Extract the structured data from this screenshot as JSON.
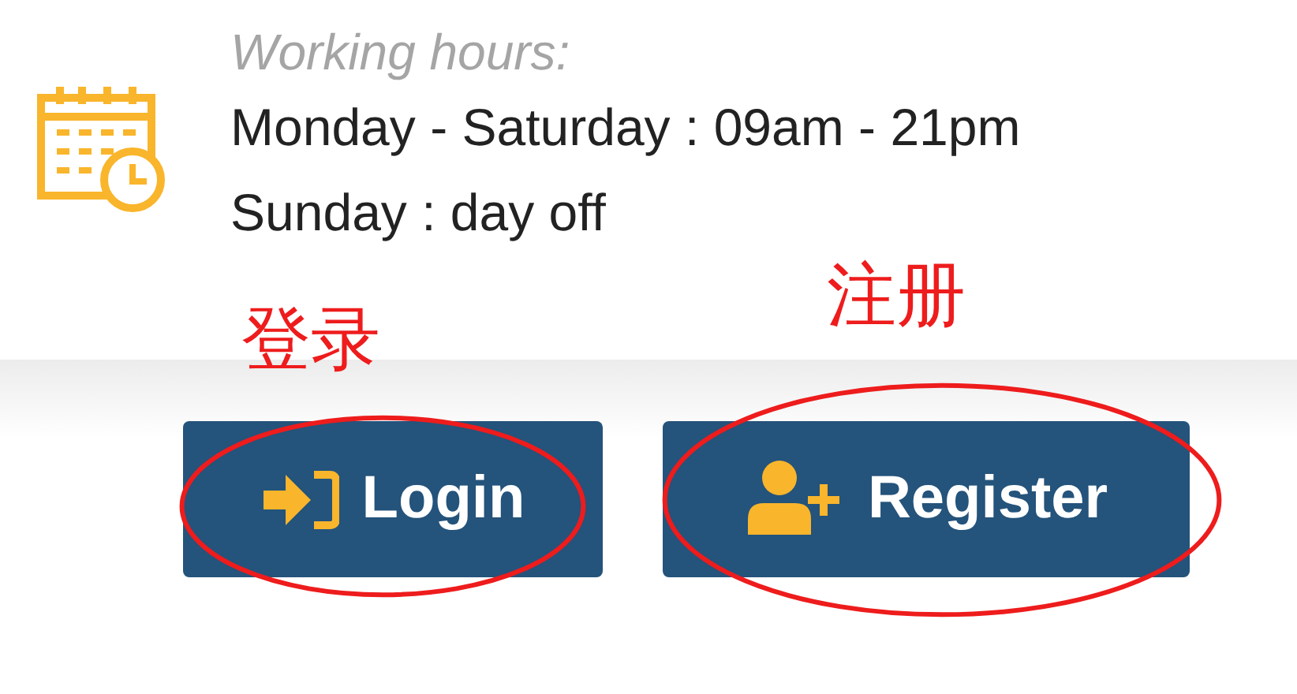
{
  "working_hours": {
    "title": "Working hours:",
    "lines": [
      "Monday - Saturday : 09am - 21pm",
      "Sunday : day off"
    ]
  },
  "buttons": [
    {
      "kind": "login",
      "label": "Login"
    },
    {
      "kind": "register",
      "label": "Register"
    }
  ],
  "annotations": [
    {
      "text": "登录"
    },
    {
      "text": "注册"
    }
  ]
}
